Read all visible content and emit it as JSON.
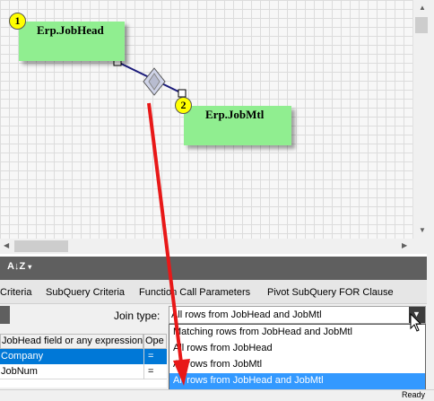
{
  "canvas": {
    "tables": [
      {
        "number": "1",
        "name": "Erp.JobHead"
      },
      {
        "number": "2",
        "name": "Erp.JobMtl"
      }
    ]
  },
  "toolbar": {
    "sort_icon_label": "A↓Z"
  },
  "tabs": [
    "Criteria",
    "SubQuery Criteria",
    "Function Call Parameters",
    "Pivot SubQuery FOR Clause"
  ],
  "join": {
    "label": "Join type:",
    "value": "All rows from JobHead and JobMtl",
    "options": [
      "Matching rows from JobHead and JobMtl",
      "All rows from JobHead",
      "All rows from JobMtl",
      "All rows from JobHead and JobMtl"
    ],
    "selected_index": 3
  },
  "grid": {
    "headers": [
      "JobHead field or any expression",
      "Ope"
    ],
    "rows": [
      {
        "field": "Company",
        "op": "="
      },
      {
        "field": "JobNum",
        "op": "="
      }
    ]
  },
  "status": {
    "text": "Ready"
  },
  "colors": {
    "table_fill": "#90ee90",
    "badge": "#ffff00",
    "selection": "#3399ff",
    "arrow": "#e81818",
    "toolbar": "#5f5f5f"
  }
}
